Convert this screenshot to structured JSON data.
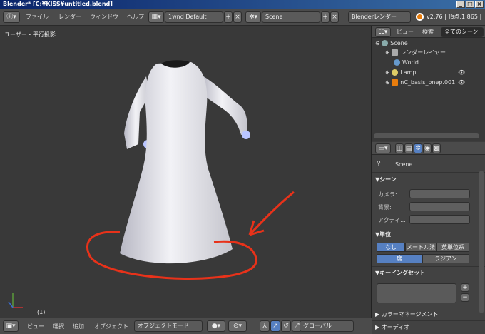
{
  "window": {
    "title": "Blender* [C:¥KISS¥untitled.blend]"
  },
  "menu": {
    "file": "ファイル",
    "render": "レンダー",
    "window": "ウィンドウ",
    "help": "ヘルプ"
  },
  "layout": {
    "name": "1wnd Default"
  },
  "scene": {
    "name": "Scene"
  },
  "engine": {
    "name": "Blenderレンダー"
  },
  "version": {
    "text": "v2.76 | 頂点:1,865 |"
  },
  "viewport": {
    "label": "ユーザー・平行投影",
    "frame": "(1)"
  },
  "bottombar": {
    "view": "ビュー",
    "select": "選択",
    "add": "追加",
    "object": "オブジェクト",
    "mode": "オブジェクトモード",
    "orientation": "グローバル"
  },
  "outliner": {
    "view": "ビュー",
    "search": "検索",
    "filter": "全てのシーン",
    "items": [
      {
        "label": "Scene"
      },
      {
        "label": "レンダーレイヤー"
      },
      {
        "label": "World"
      },
      {
        "label": "Lamp"
      },
      {
        "label": "nC_basis_onep.001"
      }
    ]
  },
  "properties": {
    "context": "Scene",
    "scene_panel": {
      "title": "▼シーン",
      "camera": "カメラ:",
      "background": "背景:",
      "active": "アクティ..."
    },
    "units_panel": {
      "title": "▼単位",
      "none": "なし",
      "metric": "メートル法",
      "imperial": "英単位系",
      "degrees": "度",
      "radians": "ラジアン"
    },
    "keying_panel": {
      "title": "▼キーイングセット"
    },
    "color_mgmt": "▶ カラーマネージメント",
    "audio": "▶ オーディオ"
  },
  "colors": {
    "accent": "#5680c2",
    "annotation": "#e8321a"
  }
}
